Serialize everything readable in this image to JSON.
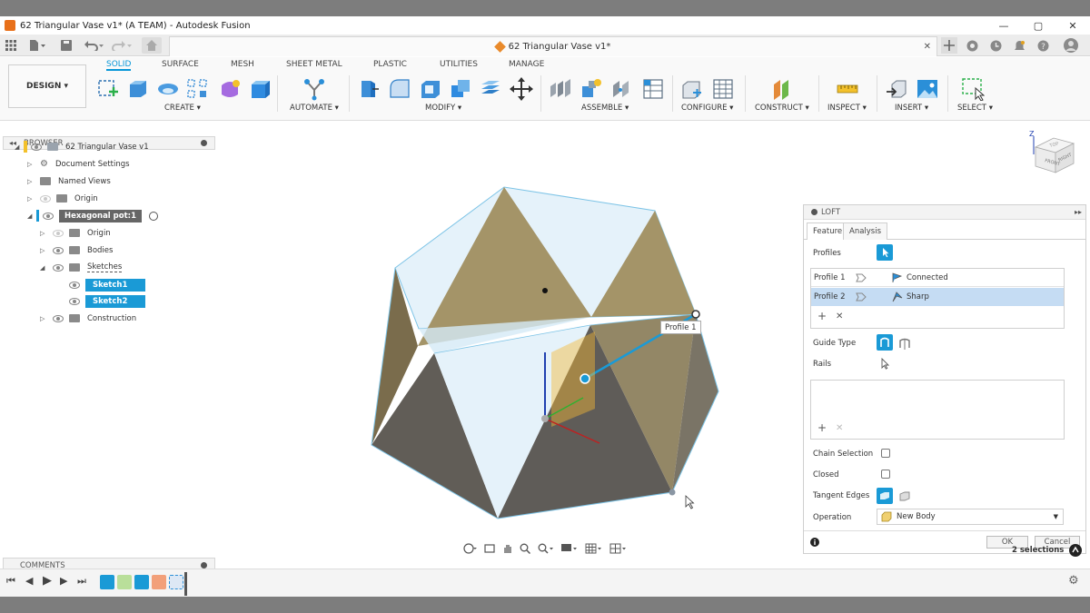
{
  "window": {
    "title": "62 Triangular Vase v1* (A TEAM) - Autodesk Fusion",
    "min": "—",
    "max": "▢",
    "close": "✕"
  },
  "doc_tab": {
    "title": "62 Triangular Vase v1*",
    "close": "✕"
  },
  "workspace": {
    "design_label": "DESIGN ▾"
  },
  "toolbar": {
    "tabs": [
      "SOLID",
      "SURFACE",
      "MESH",
      "SHEET METAL",
      "PLASTIC",
      "UTILITIES",
      "MANAGE"
    ],
    "groups": [
      "CREATE ▾",
      "AUTOMATE ▾",
      "MODIFY ▾",
      "ASSEMBLE ▾",
      "CONFIGURE ▾",
      "CONSTRUCT ▾",
      "INSPECT ▾",
      "INSERT ▾",
      "SELECT ▾"
    ]
  },
  "browser": {
    "title": "BROWSER",
    "items": [
      {
        "label": "62 Triangular Vase v1"
      },
      {
        "label": "Document Settings"
      },
      {
        "label": "Named Views"
      },
      {
        "label": "Origin"
      },
      {
        "label": "Hexagonal pot:1"
      },
      {
        "label": "Origin"
      },
      {
        "label": "Bodies"
      },
      {
        "label": "Sketches"
      },
      {
        "label": "Sketch1"
      },
      {
        "label": "Sketch2"
      },
      {
        "label": "Construction"
      }
    ]
  },
  "comments": {
    "title": "COMMENTS"
  },
  "viewport": {
    "profile_label": "Profile 1",
    "status": "2 selections"
  },
  "viewcube": {
    "axis_z": "Z",
    "front": "FRONT",
    "right": "RIGHT",
    "top": "TOP"
  },
  "loft": {
    "title": "LOFT",
    "tabs": [
      "Feature",
      "Analysis"
    ],
    "profiles_label": "Profiles",
    "profiles": [
      {
        "name": "Profile 1",
        "condition": "Connected"
      },
      {
        "name": "Profile 2",
        "condition": "Sharp"
      }
    ],
    "guide_type_label": "Guide Type",
    "rails_label": "Rails",
    "chain_selection_label": "Chain Selection",
    "closed_label": "Closed",
    "tangent_edges_label": "Tangent Edges",
    "operation_label": "Operation",
    "operation_value": "New Body",
    "ok": "OK",
    "cancel": "Cancel"
  },
  "colors": {
    "accent": "#0696d7",
    "selection": "#1a9ad6",
    "highlight_row": "#c5dcf3"
  }
}
